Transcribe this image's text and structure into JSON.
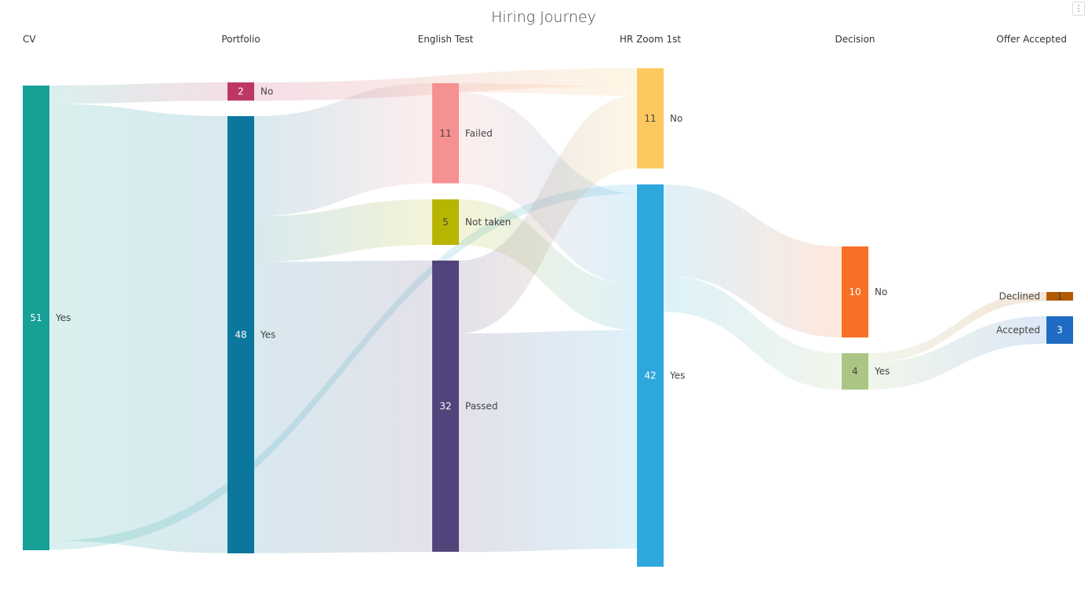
{
  "menu": {
    "icon": "more-vertical-icon",
    "glyph": "⋮"
  },
  "chart_data": {
    "type": "sankey",
    "title": "Hiring Journey",
    "stages": [
      "CV",
      "Portfolio",
      "English Test",
      "HR Zoom 1st",
      "Decision",
      "Offer Accepted"
    ],
    "nodes": [
      {
        "id": "cv_yes",
        "stage": 0,
        "label": "Yes",
        "value": 51,
        "color": "#16a096",
        "value_color": "#ffffff",
        "label_side": "right"
      },
      {
        "id": "pf_no",
        "stage": 1,
        "label": "No",
        "value": 2,
        "color": "#bd3766",
        "value_color": "#ffffff",
        "label_side": "right"
      },
      {
        "id": "pf_yes",
        "stage": 1,
        "label": "Yes",
        "value": 48,
        "color": "#0b779d",
        "value_color": "#ffffff",
        "label_side": "right"
      },
      {
        "id": "en_failed",
        "stage": 2,
        "label": "Failed",
        "value": 11,
        "color": "#f69191",
        "value_color": "#444444",
        "label_side": "right"
      },
      {
        "id": "en_nottaken",
        "stage": 2,
        "label": "Not taken",
        "value": 5,
        "color": "#b7b502",
        "value_color": "#444444",
        "label_side": "right"
      },
      {
        "id": "en_passed",
        "stage": 2,
        "label": "Passed",
        "value": 32,
        "color": "#52447a",
        "value_color": "#ffffff",
        "label_side": "right"
      },
      {
        "id": "hr_no",
        "stage": 3,
        "label": "No",
        "value": 11,
        "color": "#fdc85e",
        "value_color": "#444444",
        "label_side": "right"
      },
      {
        "id": "hr_yes",
        "stage": 3,
        "label": "Yes",
        "value": 42,
        "color": "#2ea8dc",
        "value_color": "#ffffff",
        "label_side": "right"
      },
      {
        "id": "dc_no",
        "stage": 4,
        "label": "No",
        "value": 10,
        "color": "#f77026",
        "value_color": "#ffffff",
        "label_side": "right"
      },
      {
        "id": "dc_yes",
        "stage": 4,
        "label": "Yes",
        "value": 4,
        "color": "#abc684",
        "value_color": "#444444",
        "label_side": "right"
      },
      {
        "id": "of_declined",
        "stage": 5,
        "label": "Declined",
        "value": 1,
        "color": "#b35a00",
        "value_color": "#444444",
        "label_side": "left"
      },
      {
        "id": "of_accepted",
        "stage": 5,
        "label": "Accepted",
        "value": 3,
        "color": "#1e6cc4",
        "value_color": "#ffffff",
        "label_side": "left"
      }
    ],
    "links": [
      {
        "source": "cv_yes",
        "target": "pf_no",
        "value": 2
      },
      {
        "source": "cv_yes",
        "target": "pf_yes",
        "value": 48
      },
      {
        "source": "cv_yes",
        "target": "hr_yes",
        "value": 1
      },
      {
        "source": "pf_no",
        "target": "hr_no",
        "value": 2
      },
      {
        "source": "pf_yes",
        "target": "en_failed",
        "value": 11
      },
      {
        "source": "pf_yes",
        "target": "en_nottaken",
        "value": 5
      },
      {
        "source": "pf_yes",
        "target": "en_passed",
        "value": 32
      },
      {
        "source": "en_failed",
        "target": "hr_no",
        "value": 1
      },
      {
        "source": "en_failed",
        "target": "hr_yes",
        "value": 10
      },
      {
        "source": "en_nottaken",
        "target": "hr_yes",
        "value": 5
      },
      {
        "source": "en_passed",
        "target": "hr_no",
        "value": 8
      },
      {
        "source": "en_passed",
        "target": "hr_yes",
        "value": 24
      },
      {
        "source": "hr_yes",
        "target": "dc_no",
        "value": 10
      },
      {
        "source": "hr_yes",
        "target": "dc_yes",
        "value": 4
      },
      {
        "source": "dc_yes",
        "target": "of_declined",
        "value": 1
      },
      {
        "source": "dc_yes",
        "target": "of_accepted",
        "value": 3
      }
    ]
  }
}
